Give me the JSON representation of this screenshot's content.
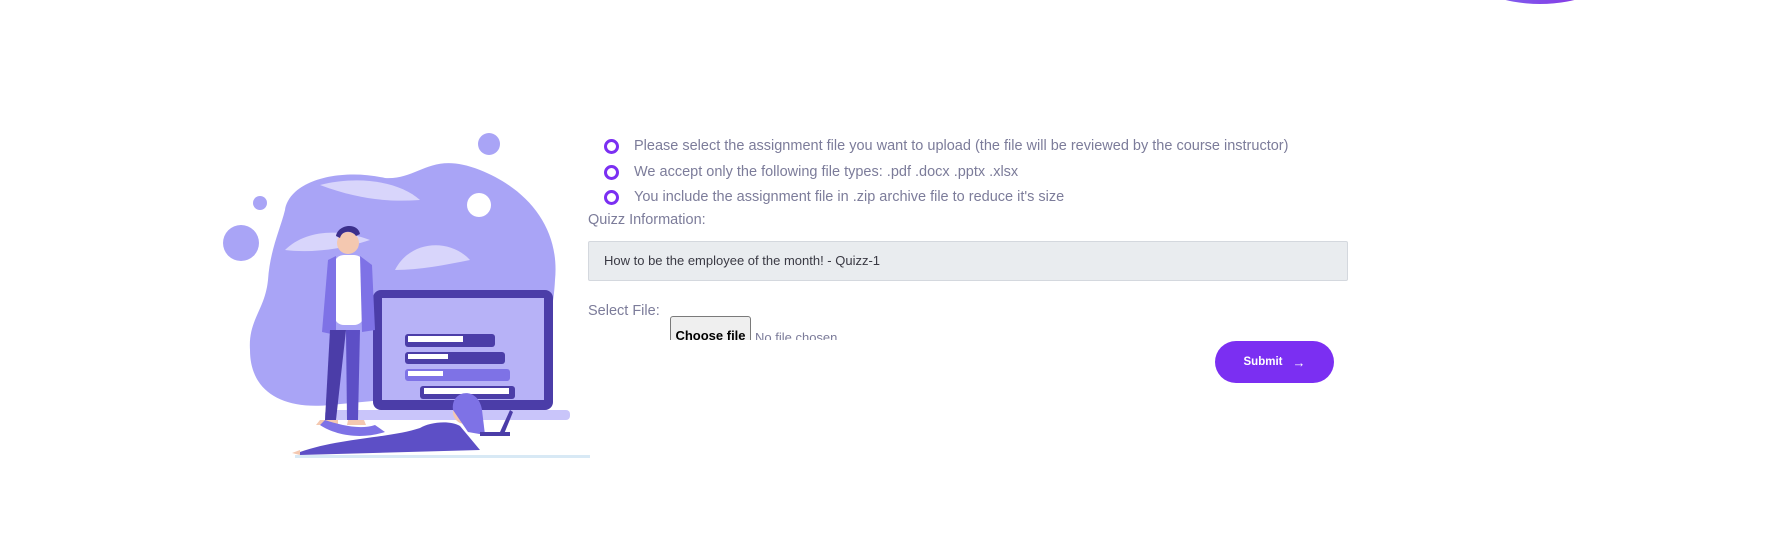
{
  "colors": {
    "accent": "#7b2ff2",
    "illustration_light": "#a9a4f6",
    "illustration_dark": "#5d4fc6"
  },
  "instructions": [
    "Please select the assignment file you want to upload (the file will be reviewed by the course instructor)",
    "We accept only the following file types: .pdf .docx .pptx .xlsx",
    "You include the assignment file in .zip archive file to reduce it's size"
  ],
  "form": {
    "quiz_label": "Quizz Information:",
    "quiz_value": "How to be the employee of the month! - Quizz-1",
    "file_label": "Select File:",
    "choose_file_label": "Choose file",
    "no_file_text": "No file chosen",
    "submit_label": "Submit",
    "submit_icon": "arrow-right-icon"
  }
}
